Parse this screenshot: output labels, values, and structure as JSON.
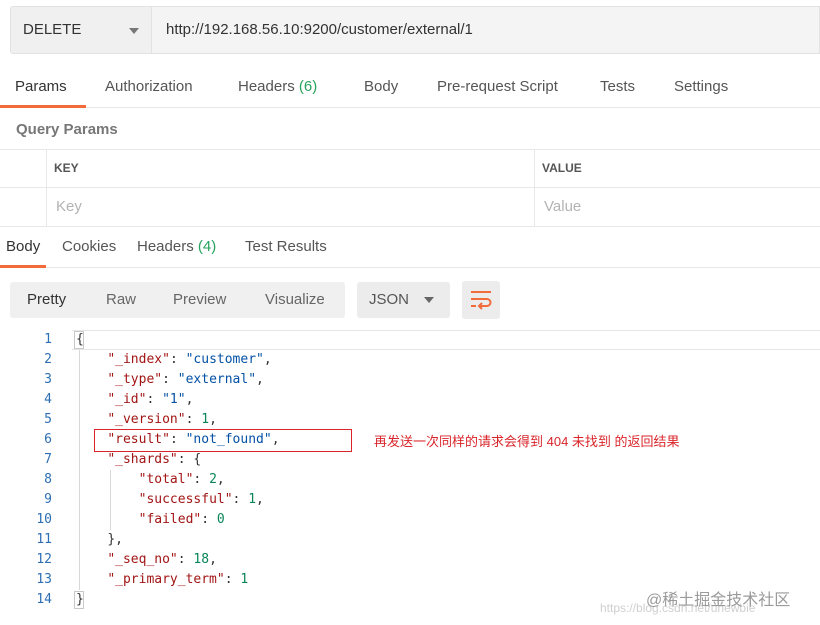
{
  "request": {
    "method": "DELETE",
    "url": "http://192.168.56.10:9200/customer/external/1"
  },
  "request_tabs": [
    {
      "label": "Params",
      "count": ""
    },
    {
      "label": "Authorization",
      "count": ""
    },
    {
      "label": "Headers",
      "count": "(6)"
    },
    {
      "label": "Body",
      "count": ""
    },
    {
      "label": "Pre-request Script",
      "count": ""
    },
    {
      "label": "Tests",
      "count": ""
    },
    {
      "label": "Settings",
      "count": ""
    }
  ],
  "query_params": {
    "title": "Query Params",
    "key_header": "KEY",
    "value_header": "VALUE",
    "key_placeholder": "Key",
    "value_placeholder": "Value"
  },
  "response_tabs": [
    {
      "label": "Body",
      "count": ""
    },
    {
      "label": "Cookies",
      "count": ""
    },
    {
      "label": "Headers",
      "count": "(4)"
    },
    {
      "label": "Test Results",
      "count": ""
    }
  ],
  "view_modes": [
    "Pretty",
    "Raw",
    "Preview",
    "Visualize"
  ],
  "format": "JSON",
  "wrap_icon": "wrap-lines-icon",
  "line_numbers": [
    "1",
    "2",
    "3",
    "4",
    "5",
    "6",
    "7",
    "8",
    "9",
    "10",
    "11",
    "12",
    "13",
    "14"
  ],
  "code": {
    "l1": "{",
    "index_key": "\"_index\"",
    "index_val": "\"customer\"",
    "type_key": "\"_type\"",
    "type_val": "\"external\"",
    "id_key": "\"_id\"",
    "id_val": "\"1\"",
    "version_key": "\"_version\"",
    "version_val": "1",
    "result_key": "\"result\"",
    "result_val": "\"not_found\"",
    "shards_key": "\"_shards\"",
    "total_key": "\"total\"",
    "total_val": "2",
    "successful_key": "\"successful\"",
    "successful_val": "1",
    "failed_key": "\"failed\"",
    "failed_val": "0",
    "shards_close": "},",
    "seq_key": "\"_seq_no\"",
    "seq_val": "18",
    "term_key": "\"_primary_term\"",
    "term_val": "1",
    "l14": "}"
  },
  "annotation": "再发送一次同样的请求会得到 404 未找到 的返回结果",
  "watermark": {
    "top": "@稀土掘金技术社区",
    "bottom": "https://blog.csdn.net/unewbie"
  },
  "colors": {
    "accent": "#f26b3a",
    "count_green": "#26a35c",
    "annotation_red": "#d9252a",
    "line_number_blue": "#2e6fb4"
  }
}
